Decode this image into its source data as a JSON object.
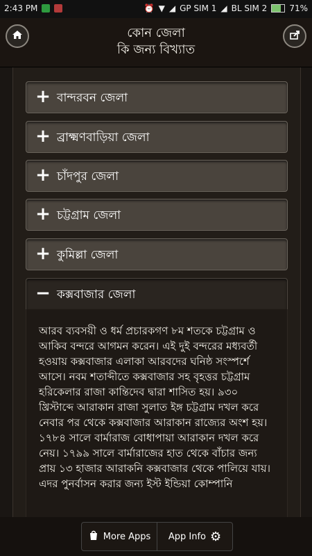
{
  "status_bar": {
    "time": "2:43 PM",
    "sim1": "GP SIM 1",
    "sim2": "BL SIM 2",
    "battery": "71%"
  },
  "header": {
    "title_line1": "কোন জেলা",
    "title_line2": "কি জন্য বিখ্যাত",
    "home_icon": "home-icon",
    "share_icon": "share-icon"
  },
  "accordion": {
    "items": [
      {
        "label": "বান্দরবন জেলা",
        "state": "collapsed"
      },
      {
        "label": "ব্রাক্ষ্মণবাড়িয়া জেলা",
        "state": "collapsed"
      },
      {
        "label": "চাঁদপুর জেলা",
        "state": "collapsed"
      },
      {
        "label": "চট্টগ্রাম জেলা",
        "state": "collapsed"
      },
      {
        "label": "কুমিল্লা জেলা",
        "state": "collapsed"
      },
      {
        "label": "কক্সবাজার জেলা",
        "state": "expanded"
      }
    ],
    "expanded_text": "আরব ব্যবসয়ী ও ধর্ম প্রচারকগণ ৮ম শতকে চট্টগ্রাম ও আকিব বন্দরে আগমন করেন। এই দুই বন্দরের মধ্যবর্তী হওয়ায় কক্সবাজার এলাকা আরবদের ঘনিষ্ঠ সংস্পর্শে আসে। নবম শতাব্দীতে কক্সবাজার সহ বৃহত্তর চট্টগ্রাম হরিকেলার রাজা কান্তিদেব দ্বারা শাসিত হয়। ৯৩০ খ্রিস্টাব্দে আরাকান রাজা সুলাত ইঙ্গ চট্টগ্রাম দখল করে নেবার পর থেকে কক্সবাজার আরাকান রাজ্যের অংশ হয়। ১৭৮৪ সালে বার্মারাজ বোধাপায়া আরাকান দখল করে নেয়। ১৭৯৯ সালে বার্মারাজের হাত থেকে বাঁচার জন্য প্রায় ১৩ হাজার আরাকনি কক্সবাজার থেকে পালিয়ে যায়। এদর পুনর্বাসন করার জন্য ইস্ট ইন্ডিয়া কোম্পানি"
  },
  "bottom_bar": {
    "more_apps": "More Apps",
    "app_info": "App Info"
  },
  "colors": {
    "background": "#1a1613",
    "panel": "#4a443d",
    "text": "#f3f0e8"
  }
}
